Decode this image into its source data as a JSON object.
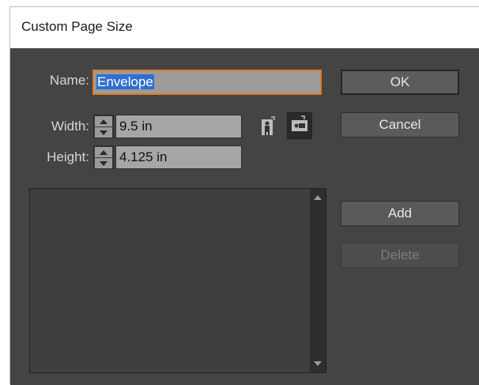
{
  "dialog": {
    "title": "Custom Page Size"
  },
  "form": {
    "name_label": "Name:",
    "name_value": "Envelope",
    "width_label": "Width:",
    "width_value": "9.5 in",
    "height_label": "Height:",
    "height_value": "4.125 in"
  },
  "orientation": {
    "selected": "landscape",
    "options": [
      "portrait",
      "landscape"
    ]
  },
  "buttons": {
    "ok": "OK",
    "cancel": "Cancel",
    "add": "Add",
    "delete": "Delete"
  },
  "colors": {
    "dialog_bg": "#444444",
    "focus_border": "#e07b24",
    "selection": "#2f6fd1"
  }
}
